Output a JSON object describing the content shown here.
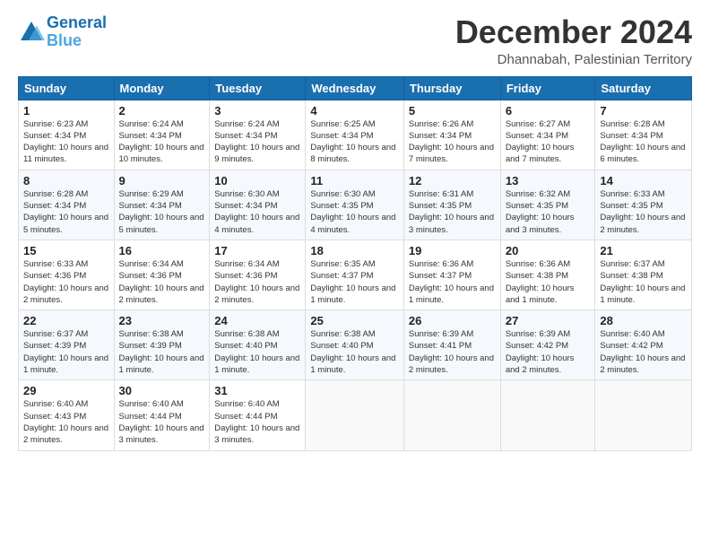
{
  "logo": {
    "line1": "General",
    "line2": "Blue"
  },
  "title": "December 2024",
  "location": "Dhannabah, Palestinian Territory",
  "days_of_week": [
    "Sunday",
    "Monday",
    "Tuesday",
    "Wednesday",
    "Thursday",
    "Friday",
    "Saturday"
  ],
  "weeks": [
    [
      {
        "day": 1,
        "sunrise": "6:23 AM",
        "sunset": "4:34 PM",
        "daylight": "10 hours and 11 minutes."
      },
      {
        "day": 2,
        "sunrise": "6:24 AM",
        "sunset": "4:34 PM",
        "daylight": "10 hours and 10 minutes."
      },
      {
        "day": 3,
        "sunrise": "6:24 AM",
        "sunset": "4:34 PM",
        "daylight": "10 hours and 9 minutes."
      },
      {
        "day": 4,
        "sunrise": "6:25 AM",
        "sunset": "4:34 PM",
        "daylight": "10 hours and 8 minutes."
      },
      {
        "day": 5,
        "sunrise": "6:26 AM",
        "sunset": "4:34 PM",
        "daylight": "10 hours and 7 minutes."
      },
      {
        "day": 6,
        "sunrise": "6:27 AM",
        "sunset": "4:34 PM",
        "daylight": "10 hours and 7 minutes."
      },
      {
        "day": 7,
        "sunrise": "6:28 AM",
        "sunset": "4:34 PM",
        "daylight": "10 hours and 6 minutes."
      }
    ],
    [
      {
        "day": 8,
        "sunrise": "6:28 AM",
        "sunset": "4:34 PM",
        "daylight": "10 hours and 5 minutes."
      },
      {
        "day": 9,
        "sunrise": "6:29 AM",
        "sunset": "4:34 PM",
        "daylight": "10 hours and 5 minutes."
      },
      {
        "day": 10,
        "sunrise": "6:30 AM",
        "sunset": "4:34 PM",
        "daylight": "10 hours and 4 minutes."
      },
      {
        "day": 11,
        "sunrise": "6:30 AM",
        "sunset": "4:35 PM",
        "daylight": "10 hours and 4 minutes."
      },
      {
        "day": 12,
        "sunrise": "6:31 AM",
        "sunset": "4:35 PM",
        "daylight": "10 hours and 3 minutes."
      },
      {
        "day": 13,
        "sunrise": "6:32 AM",
        "sunset": "4:35 PM",
        "daylight": "10 hours and 3 minutes."
      },
      {
        "day": 14,
        "sunrise": "6:33 AM",
        "sunset": "4:35 PM",
        "daylight": "10 hours and 2 minutes."
      }
    ],
    [
      {
        "day": 15,
        "sunrise": "6:33 AM",
        "sunset": "4:36 PM",
        "daylight": "10 hours and 2 minutes."
      },
      {
        "day": 16,
        "sunrise": "6:34 AM",
        "sunset": "4:36 PM",
        "daylight": "10 hours and 2 minutes."
      },
      {
        "day": 17,
        "sunrise": "6:34 AM",
        "sunset": "4:36 PM",
        "daylight": "10 hours and 2 minutes."
      },
      {
        "day": 18,
        "sunrise": "6:35 AM",
        "sunset": "4:37 PM",
        "daylight": "10 hours and 1 minute."
      },
      {
        "day": 19,
        "sunrise": "6:36 AM",
        "sunset": "4:37 PM",
        "daylight": "10 hours and 1 minute."
      },
      {
        "day": 20,
        "sunrise": "6:36 AM",
        "sunset": "4:38 PM",
        "daylight": "10 hours and 1 minute."
      },
      {
        "day": 21,
        "sunrise": "6:37 AM",
        "sunset": "4:38 PM",
        "daylight": "10 hours and 1 minute."
      }
    ],
    [
      {
        "day": 22,
        "sunrise": "6:37 AM",
        "sunset": "4:39 PM",
        "daylight": "10 hours and 1 minute."
      },
      {
        "day": 23,
        "sunrise": "6:38 AM",
        "sunset": "4:39 PM",
        "daylight": "10 hours and 1 minute."
      },
      {
        "day": 24,
        "sunrise": "6:38 AM",
        "sunset": "4:40 PM",
        "daylight": "10 hours and 1 minute."
      },
      {
        "day": 25,
        "sunrise": "6:38 AM",
        "sunset": "4:40 PM",
        "daylight": "10 hours and 1 minute."
      },
      {
        "day": 26,
        "sunrise": "6:39 AM",
        "sunset": "4:41 PM",
        "daylight": "10 hours and 2 minutes."
      },
      {
        "day": 27,
        "sunrise": "6:39 AM",
        "sunset": "4:42 PM",
        "daylight": "10 hours and 2 minutes."
      },
      {
        "day": 28,
        "sunrise": "6:40 AM",
        "sunset": "4:42 PM",
        "daylight": "10 hours and 2 minutes."
      }
    ],
    [
      {
        "day": 29,
        "sunrise": "6:40 AM",
        "sunset": "4:43 PM",
        "daylight": "10 hours and 2 minutes."
      },
      {
        "day": 30,
        "sunrise": "6:40 AM",
        "sunset": "4:44 PM",
        "daylight": "10 hours and 3 minutes."
      },
      {
        "day": 31,
        "sunrise": "6:40 AM",
        "sunset": "4:44 PM",
        "daylight": "10 hours and 3 minutes."
      },
      null,
      null,
      null,
      null
    ]
  ]
}
